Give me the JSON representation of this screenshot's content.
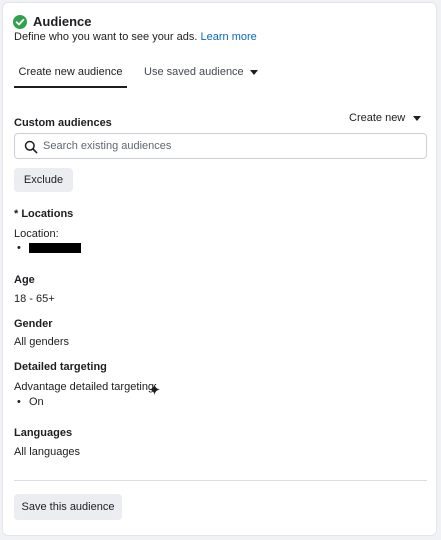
{
  "section": {
    "title": "Audience",
    "subtitle": "Define who you want to see your ads.",
    "learn_more": "Learn more"
  },
  "tabs": [
    {
      "label": "Create new audience",
      "active": true
    },
    {
      "label": "Use saved audience",
      "active": false
    }
  ],
  "custom_audiences": {
    "label": "Custom audiences",
    "create_new": "Create new",
    "search_placeholder": "Search existing audiences",
    "search_value": "",
    "exclude_label": "Exclude"
  },
  "locations": {
    "label": "* Locations",
    "sub_label": "Location:",
    "bullet": "•"
  },
  "age": {
    "label": "Age",
    "value": "18 - 65+"
  },
  "gender": {
    "label": "Gender",
    "value": "All genders"
  },
  "detailed_targeting": {
    "label": "Detailed targeting",
    "advantage_label": "Advantage detailed targeting:",
    "bullet": "•",
    "value": "On"
  },
  "languages": {
    "label": "Languages",
    "value": "All languages"
  },
  "footer": {
    "save_label": "Save this audience"
  },
  "colors": {
    "check": "#31a24c",
    "link": "#0a66c2",
    "button_bg": "#ebedf0",
    "border": "#ccd0d5"
  },
  "icons": [
    "check-circle-icon",
    "caret-down-icon",
    "search-icon",
    "sparkle-icon"
  ]
}
